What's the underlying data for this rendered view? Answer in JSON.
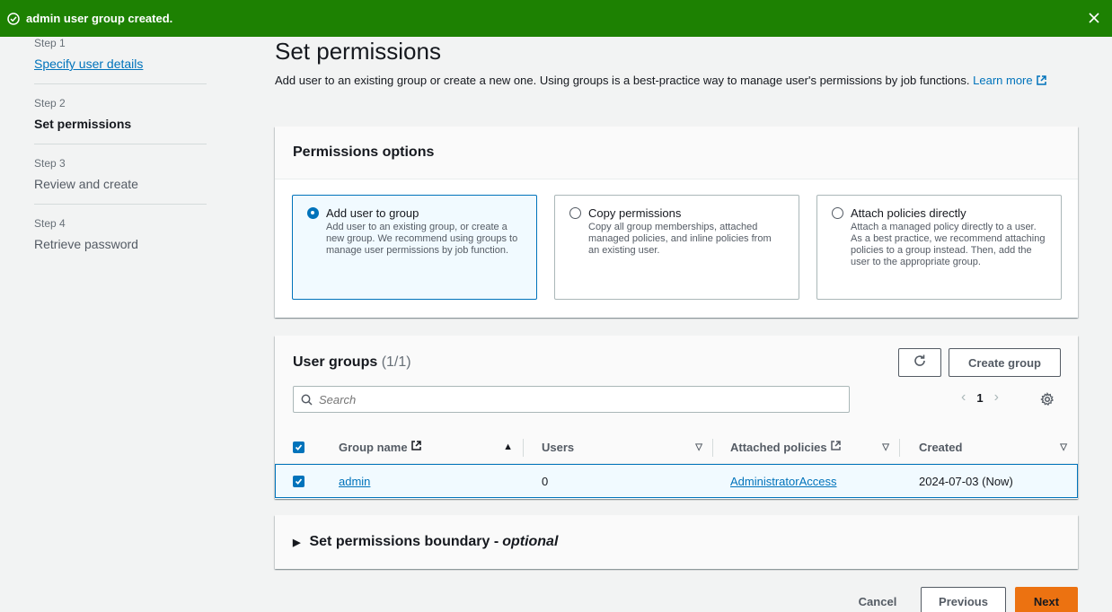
{
  "flash": {
    "message": "admin user group created.",
    "color": "#1d8102"
  },
  "steps": [
    {
      "num": "Step 1",
      "label": "Specify user details",
      "state": "link"
    },
    {
      "num": "Step 2",
      "label": "Set permissions",
      "state": "active"
    },
    {
      "num": "Step 3",
      "label": "Review and create",
      "state": "future"
    },
    {
      "num": "Step 4",
      "label": "Retrieve password",
      "state": "future"
    }
  ],
  "main": {
    "title": "Set permissions",
    "description": "Add user to an existing group or create a new one. Using groups is a best-practice way to manage user's permissions by job functions.",
    "learn_more": "Learn more"
  },
  "permissions_options": {
    "heading": "Permissions options",
    "options": [
      {
        "title": "Add user to group",
        "desc": "Add user to an existing group, or create a new group. We recommend using groups to manage user permissions by job function.",
        "selected": true
      },
      {
        "title": "Copy permissions",
        "desc": "Copy all group memberships, attached managed policies, and inline policies from an existing user.",
        "selected": false
      },
      {
        "title": "Attach policies directly",
        "desc": "Attach a managed policy directly to a user. As a best practice, we recommend attaching policies to a group instead. Then, add the user to the appropriate group.",
        "selected": false
      }
    ]
  },
  "user_groups": {
    "heading": "User groups",
    "count": "(1/1)",
    "create_label": "Create group",
    "search_placeholder": "Search",
    "page": "1",
    "columns": [
      "Group name",
      "Users",
      "Attached policies",
      "Created"
    ],
    "rows": [
      {
        "group_name": "admin",
        "users": "0",
        "attached_policies": "AdministratorAccess",
        "created": "2024-07-03 (Now)",
        "checked": true
      }
    ]
  },
  "boundary": {
    "label": "Set permissions boundary - ",
    "optional": "optional"
  },
  "footer": {
    "cancel": "Cancel",
    "previous": "Previous",
    "next": "Next"
  },
  "colors": {
    "accent": "#0073bb",
    "primary_button": "#ec7211",
    "success": "#1d8102"
  }
}
